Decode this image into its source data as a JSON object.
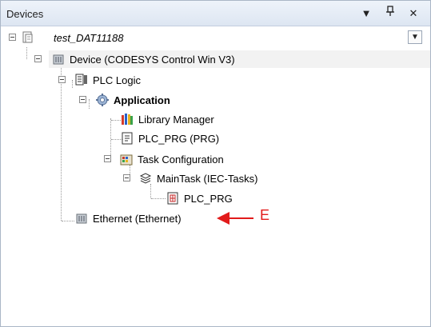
{
  "panel": {
    "title": "Devices",
    "controls": {
      "dropdown": "▼",
      "pin": "Ⴤ",
      "close": "✕"
    }
  },
  "tree": {
    "project": "test_DAT11188",
    "device": "Device (CODESYS Control Win V3)",
    "plc_logic": "PLC Logic",
    "application": "Application",
    "library_manager": "Library Manager",
    "plc_prg": "PLC_PRG (PRG)",
    "task_configuration": "Task Configuration",
    "main_task": "MainTask (IEC-Tasks)",
    "task_plc_prg": "PLC_PRG",
    "ethernet": "Ethernet (Ethernet)"
  },
  "annotation": {
    "label": "E",
    "color": "#e21b1b"
  }
}
